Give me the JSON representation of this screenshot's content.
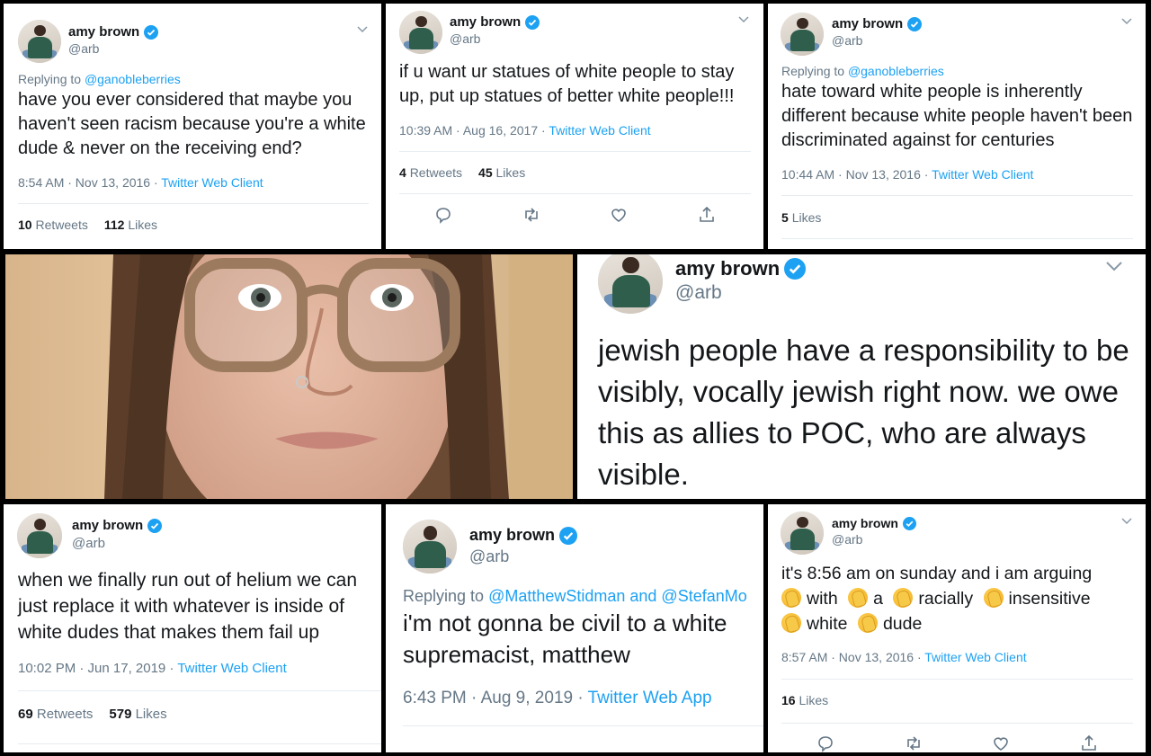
{
  "author": {
    "name": "amy brown",
    "handle": "@arb"
  },
  "tweets": [
    {
      "reply_prefix": "Replying to ",
      "reply_to": "@ganobleberries",
      "text": "have you ever considered that maybe you haven't seen racism because you're a white dude & never on the receiving end?",
      "time": "8:54 AM · Nov 13, 2016 · ",
      "source": "Twitter Web Client",
      "retweets": "10",
      "retweets_label": "Retweets",
      "likes": "112",
      "likes_label": "Likes"
    },
    {
      "text": "if u want ur statues of white people to stay up, put up statues of better white people!!!",
      "time": "10:39 AM · Aug 16, 2017 · ",
      "source": "Twitter Web Client",
      "retweets": "4",
      "retweets_label": "Retweets",
      "likes": "45",
      "likes_label": "Likes"
    },
    {
      "reply_prefix": "Replying to ",
      "reply_to": "@ganobleberries",
      "text": "hate toward white people is inherently different because white people haven't been discriminated against for centuries",
      "time": "10:44 AM · Nov 13, 2016 · ",
      "source": "Twitter Web Client",
      "likes": "5",
      "likes_label": "Likes"
    },
    {
      "text": "jewish people have a responsibility to be visibly, vocally jewish right now. we owe this as allies to POC, who are always visible."
    },
    {
      "text": "when we finally run out of helium we can just replace it with whatever is inside of white dudes that makes them fail up",
      "time": "10:02 PM · Jun 17, 2019 · ",
      "source": "Twitter Web Client",
      "retweets": "69",
      "retweets_label": "Retweets",
      "likes": "579",
      "likes_label": "Likes"
    },
    {
      "reply_prefix": "Replying to ",
      "reply_to": "@MatthewStidman and @StefanMo",
      "text": "i'm not gonna be civil to a white supremacist, matthew",
      "time": "6:43 PM · Aug 9, 2019 · ",
      "source": "Twitter Web App"
    },
    {
      "text_line1": "it's 8:56 am on sunday and i am arguing",
      "clap_words": [
        "with",
        "a",
        "racially",
        "insensitive",
        "white",
        "dude"
      ],
      "time": "8:57 AM · Nov 13, 2016 · ",
      "source": "Twitter Web Client",
      "likes": "16",
      "likes_label": "Likes"
    }
  ],
  "icons": [
    "verified-badge-icon",
    "chevron-down-icon",
    "reply-icon",
    "retweet-icon",
    "like-icon",
    "share-icon",
    "clapping-hands-emoji"
  ],
  "colors": {
    "link": "#1da1f2",
    "muted": "#657786",
    "text": "#14171a",
    "divider": "#e6ecf0"
  }
}
